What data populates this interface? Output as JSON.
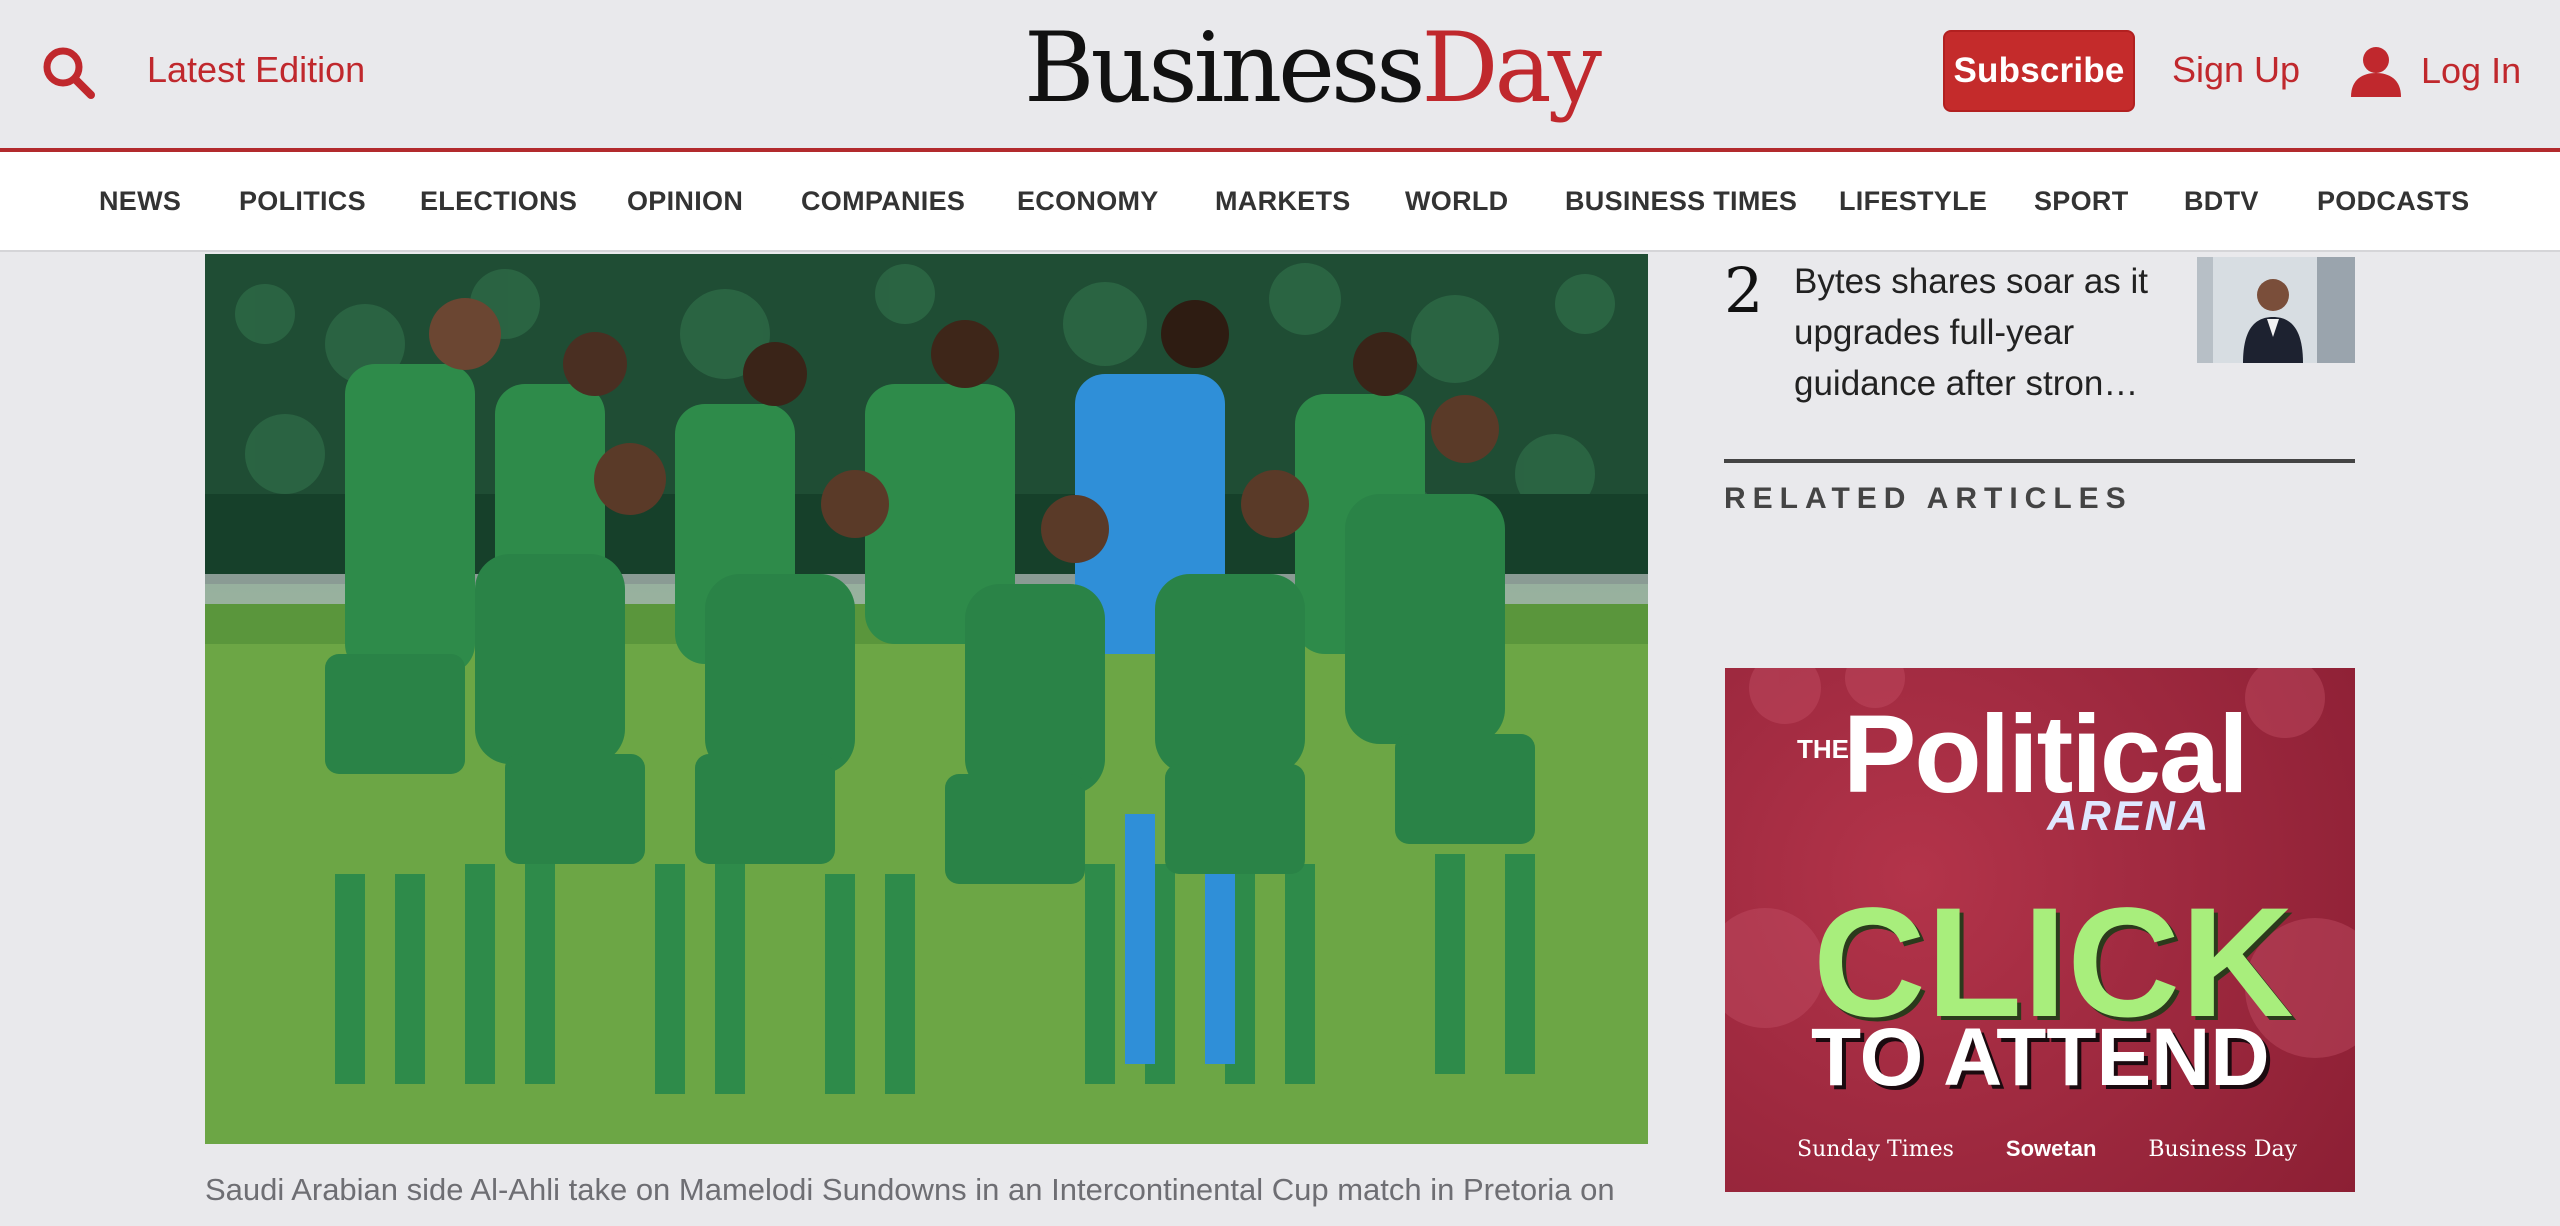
{
  "header": {
    "latest_edition": "Latest Edition",
    "logo_part1": "Business",
    "logo_part2": "Day",
    "subscribe": "Subscribe",
    "sign_up": "Sign Up",
    "log_in": "Log In"
  },
  "nav": {
    "items": [
      "NEWS",
      "POLITICS",
      "ELECTIONS",
      "OPINION",
      "COMPANIES",
      "ECONOMY",
      "MARKETS",
      "WORLD",
      "BUSINESS TIMES",
      "LIFESTYLE",
      "SPORT",
      "BDTV",
      "PODCASTS"
    ]
  },
  "article": {
    "caption": "Saudi Arabian side Al-Ahli take on Mamelodi Sundowns in an Intercontinental Cup match in Pretoria on"
  },
  "sidebar": {
    "trending_number": "2",
    "trending_title": "Bytes shares soar as it upgrades full-year guidance after stron…",
    "related_heading": "RELATED ARTICLES"
  },
  "ad": {
    "the": "THE",
    "political": "Political",
    "arena": "ARENA",
    "click": "CLICK",
    "attend": "TO ATTEND",
    "sponsors": [
      "Sunday Times",
      "Sowetan",
      "Business Day"
    ]
  },
  "colors": {
    "brand_red": "#c0282d",
    "background": "#e9e9ec"
  }
}
